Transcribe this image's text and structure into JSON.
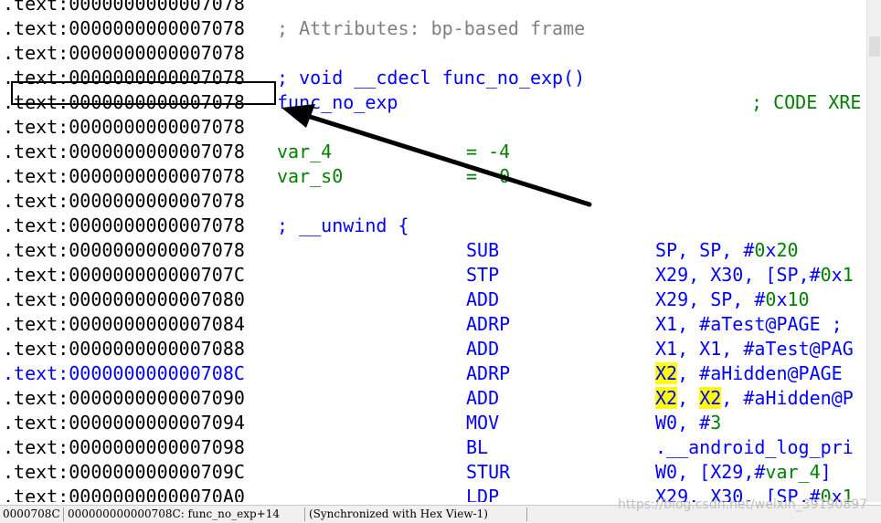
{
  "listing": {
    "rows": [
      {
        "addr": ".text:0000000000007078"
      },
      {
        "addr": ".text:0000000000007078",
        "comment": "; Attributes: bp-based frame"
      },
      {
        "addr": ".text:0000000000007078"
      },
      {
        "addr": ".text:0000000000007078",
        "decl": "; void __cdecl func_no_exp()"
      },
      {
        "addr": ".text:0000000000007078",
        "label": "func_no_exp",
        "xref": "; CODE XRE"
      },
      {
        "addr": ".text:0000000000007078"
      },
      {
        "addr": ".text:0000000000007078",
        "var": "var_4",
        "var_value": "= -4"
      },
      {
        "addr": ".text:0000000000007078",
        "var": "var_s0",
        "var_value": "=  0"
      },
      {
        "addr": ".text:0000000000007078"
      },
      {
        "addr": ".text:0000000000007078",
        "decl": "; __unwind {"
      },
      {
        "addr": ".text:0000000000007078",
        "mnemonic": "SUB",
        "operands": "SP, SP, #0x20"
      },
      {
        "addr": ".text:000000000000707C",
        "mnemonic": "STP",
        "operands": "X29, X30, [SP,#0x1"
      },
      {
        "addr": ".text:0000000000007080",
        "mnemonic": "ADD",
        "operands": "X29, SP, #0x10"
      },
      {
        "addr": ".text:0000000000007084",
        "mnemonic": "ADRP",
        "operands": "X1, #aTest@PAGE ;"
      },
      {
        "addr": ".text:0000000000007088",
        "mnemonic": "ADD",
        "operands": "X1, X1, #aTest@PAG"
      },
      {
        "addr": ".text:000000000000708C",
        "mnemonic": "ADRP",
        "operands": "X2, #aHidden@PAGE"
      },
      {
        "addr": ".text:0000000000007090",
        "mnemonic": "ADD",
        "operands": "X2, X2, #aHidden@P"
      },
      {
        "addr": ".text:0000000000007094",
        "mnemonic": "MOV",
        "operands": "W0, #3"
      },
      {
        "addr": ".text:0000000000007098",
        "mnemonic": "BL",
        "operands": ".__android_log_pri"
      },
      {
        "addr": ".text:000000000000709C",
        "mnemonic": "STUR",
        "operands": "W0, [X29,#var_4]"
      },
      {
        "addr": ".text:00000000000070A0",
        "mnemonic": "LDP",
        "operands": "X29, X30, [SP,#0x1"
      }
    ],
    "current_row": 15,
    "highlight_token": "X2"
  },
  "status": {
    "offset": "0000708C",
    "location": "000000000000708C: func_no_exp+14",
    "sync": "(Synchronized with Hex View-1)"
  },
  "watermark": "https://blog.csdn.net/weixin_39190897",
  "colors": {
    "address": "#000000",
    "current_address": "#0000ff",
    "comment": "#808080",
    "keyword": "#0000ff",
    "local_var": "#008000",
    "highlight": "#ffff00",
    "arrow": "#000000"
  }
}
